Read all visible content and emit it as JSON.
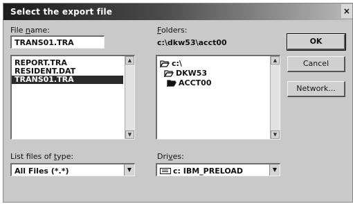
{
  "dialog": {
    "title": "Select the export file",
    "close_label": "×"
  },
  "file_name": {
    "label_prefix": "File ",
    "label_mnemonic": "n",
    "label_suffix": "ame:",
    "value": "TRANS01.TRA"
  },
  "files": {
    "items": [
      {
        "name": "REPORT.TRA",
        "selected": false
      },
      {
        "name": "RESIDENT.DAT",
        "selected": false
      },
      {
        "name": "TRANS01.TRA",
        "selected": true
      }
    ]
  },
  "folders": {
    "label_mnemonic": "F",
    "label_suffix": "olders:",
    "current_path": "c:\\dkw53\\acct00",
    "tree": [
      {
        "name": "c:\\",
        "open": true
      },
      {
        "name": "DKW53",
        "open": true
      },
      {
        "name": "ACCT00",
        "open": true
      }
    ]
  },
  "list_type": {
    "label_prefix": "List files of ",
    "label_mnemonic": "t",
    "label_suffix": "ype:",
    "value": "All Files (*.*)"
  },
  "drives": {
    "label_prefix": "Dri",
    "label_mnemonic": "v",
    "label_suffix": "es:",
    "value": "c: IBM_PRELOAD",
    "icon": "drive-icon"
  },
  "buttons": {
    "ok": "OK",
    "cancel": "Cancel",
    "network": "Network..."
  },
  "colors": {
    "title_start": "#1c1c1c",
    "selection": "#2a2a2a",
    "dialog_bg": "#c9c9c9"
  }
}
